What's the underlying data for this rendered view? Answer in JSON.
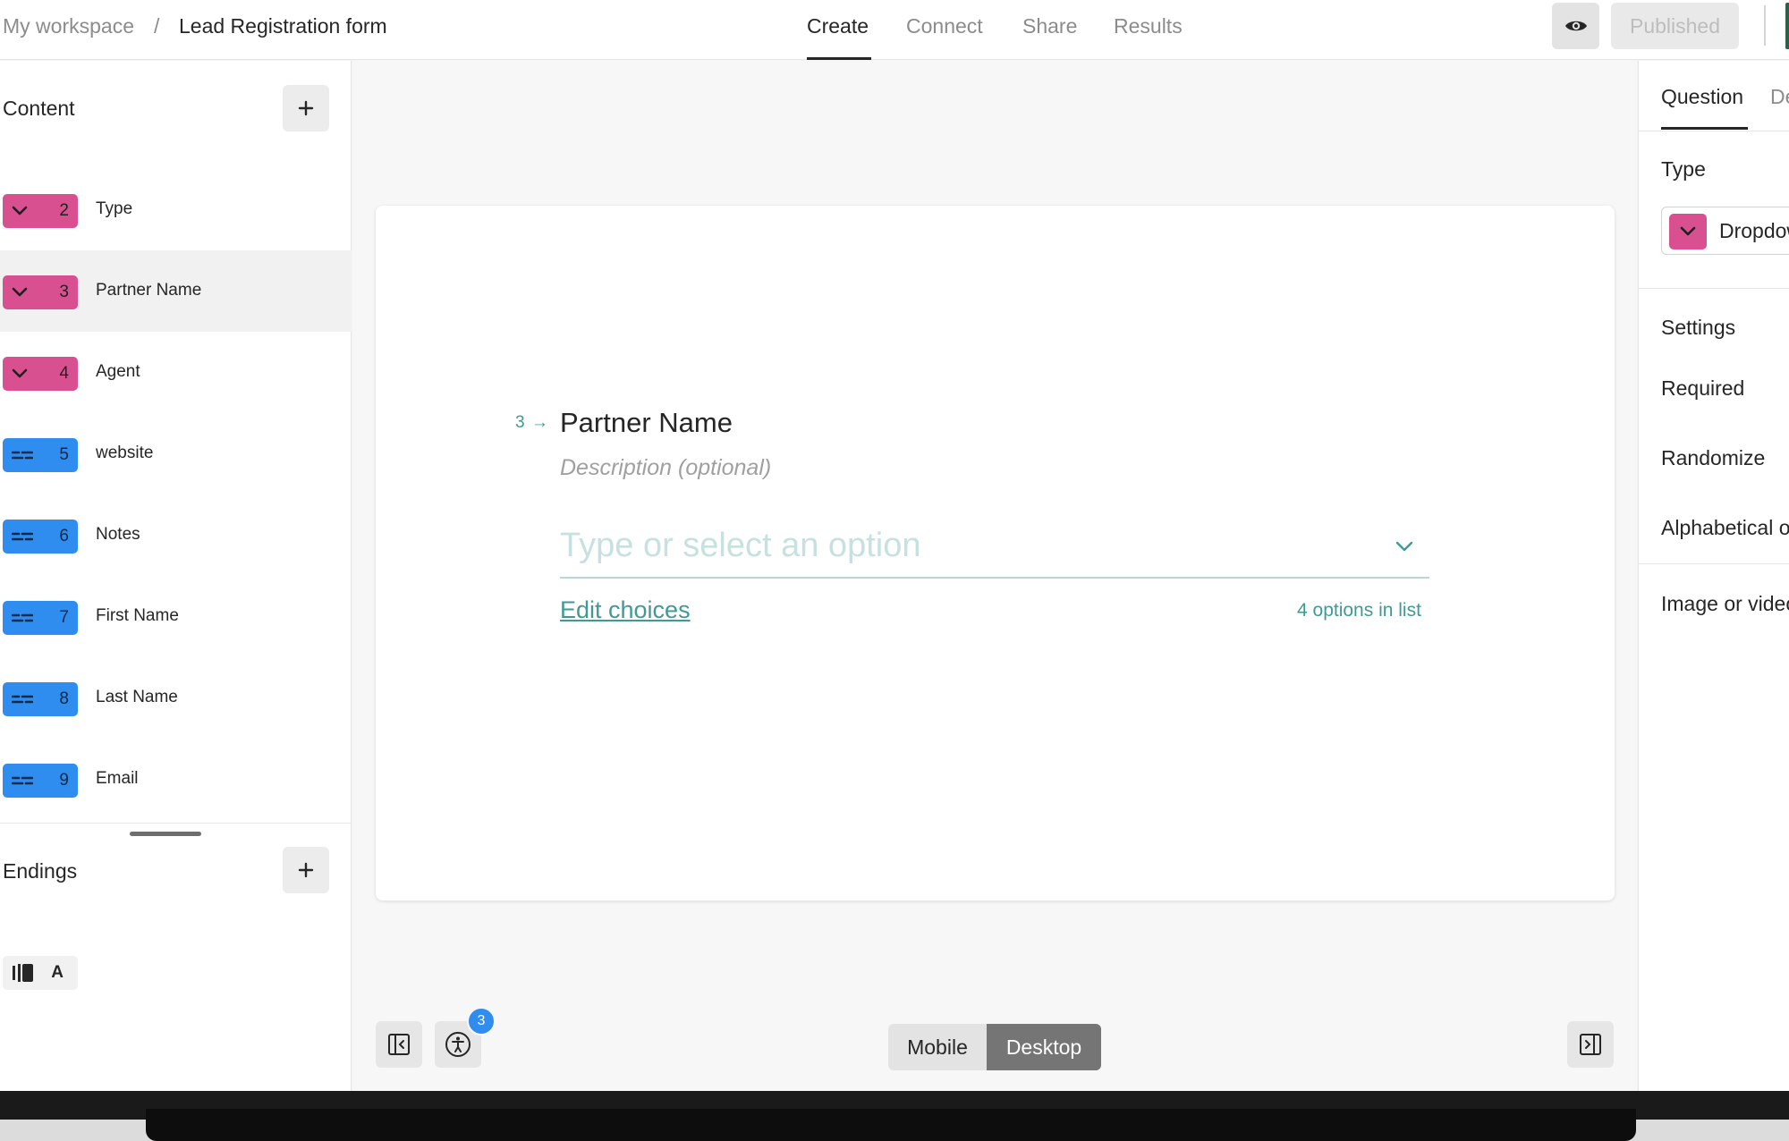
{
  "header": {
    "breadcrumb": {
      "workspace": "My workspace",
      "separator": "/",
      "form_name": "Lead Registration form"
    },
    "tabs": [
      {
        "label": "Create",
        "active": true
      },
      {
        "label": "Connect",
        "active": false
      },
      {
        "label": "Share",
        "active": false
      },
      {
        "label": "Results",
        "active": false
      }
    ],
    "preview_icon": "eye-icon",
    "publish_label": "Published"
  },
  "sidebar": {
    "content_title": "Content",
    "add_icon": "plus-icon",
    "items": [
      {
        "number": "2",
        "label": "Type",
        "icon": "dropdown-chevron-icon",
        "color": "#d8508f"
      },
      {
        "number": "3",
        "label": "Partner Name",
        "icon": "dropdown-chevron-icon",
        "color": "#d8508f",
        "selected": true
      },
      {
        "number": "4",
        "label": "Agent",
        "icon": "dropdown-chevron-icon",
        "color": "#d8508f"
      },
      {
        "number": "5",
        "label": "website",
        "icon": "short-text-icon",
        "color": "#2e8def"
      },
      {
        "number": "6",
        "label": "Notes",
        "icon": "short-text-icon",
        "color": "#2e8def"
      },
      {
        "number": "7",
        "label": "First Name",
        "icon": "short-text-icon",
        "color": "#2e8def"
      },
      {
        "number": "8",
        "label": "Last Name",
        "icon": "short-text-icon",
        "color": "#2e8def"
      },
      {
        "number": "9",
        "label": "Email",
        "icon": "short-text-icon",
        "color": "#2e8def"
      }
    ],
    "endings_title": "Endings",
    "ending": {
      "icon": "ending-screen-icon",
      "letter": "A"
    }
  },
  "question": {
    "number": "3",
    "arrow": "→",
    "title": "Partner Name",
    "description_placeholder": "Description (optional)",
    "input_placeholder": "Type or select an option",
    "edit_choices": "Edit choices",
    "options_count": "4 options in list"
  },
  "canvas_toolbar": {
    "collapse_left_icon": "collapse-left-panel-icon",
    "accessibility_icon": "accessibility-icon",
    "notification_count": "3",
    "device_options": [
      "Mobile",
      "Desktop"
    ],
    "selected_device": "Desktop",
    "collapse_right_icon": "collapse-right-panel-icon"
  },
  "right_panel": {
    "tabs": [
      {
        "label": "Question",
        "active": true
      },
      {
        "label": "Design",
        "active": false
      }
    ],
    "type_label": "Type",
    "type_value": "Dropdown",
    "settings_label": "Settings",
    "settings": [
      "Required",
      "Randomize",
      "Alphabetical order"
    ],
    "media_label": "Image or video"
  },
  "colors": {
    "accent_teal": "#3f9a96",
    "dropdown_pink": "#d8508f",
    "text_blue": "#2e8def"
  }
}
